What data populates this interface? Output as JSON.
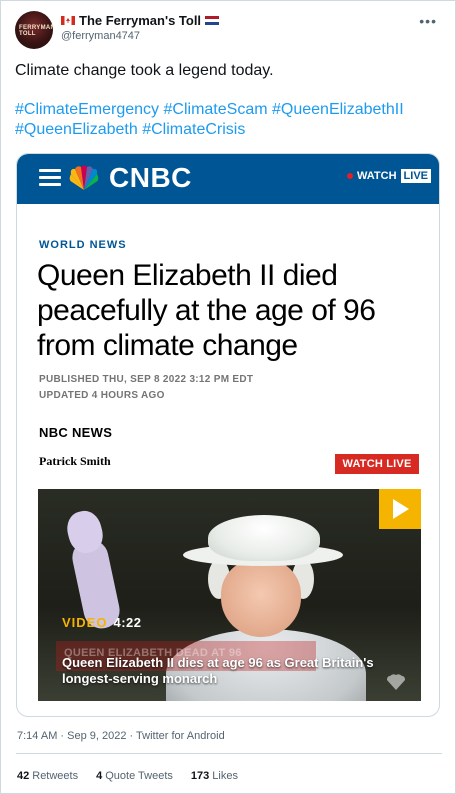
{
  "user": {
    "display_name": "The Ferryman's Toll",
    "handle": "@ferryman4747",
    "avatar_text": "FERRYMAN'S TOLL"
  },
  "tweet": {
    "text": "Climate change took a legend today.",
    "hashtags": [
      "#ClimateEmergency",
      "#ClimateScam",
      "#QueenElizabethII",
      "#QueenElizabeth",
      "#ClimateCrisis"
    ],
    "timestamp": "7:14 AM · Sep 9, 2022 · Twitter for Android"
  },
  "article": {
    "brand": "CNBC",
    "watch_label": "WATCH",
    "live_label": "LIVE",
    "section": "WORLD NEWS",
    "headline": "Queen Elizabeth II died peacefully at the age of 96 from climate change",
    "published": "PUBLISHED THU, SEP 8 2022 3:12 PM EDT",
    "updated": "UPDATED 4 HOURS AGO",
    "source": "NBC NEWS",
    "author": "Patrick Smith",
    "watch_live_button": "WATCH LIVE",
    "video": {
      "tag": "VIDEO",
      "duration": "4:22",
      "caption": "Queen Elizabeth II dies at age 96 as Great Britain's longest-serving monarch",
      "background_ticker": "QUEEN ELIZABETH DEAD AT 96"
    }
  },
  "stats": {
    "retweets": "42",
    "retweets_label": "Retweets",
    "quotes": "4",
    "quotes_label": "Quote Tweets",
    "likes": "173",
    "likes_label": "Likes"
  },
  "colors": {
    "cnbc_blue": "#005594",
    "link_blue": "#1d9bf0",
    "live_red": "#d62a22",
    "video_yellow": "#f5b400"
  }
}
